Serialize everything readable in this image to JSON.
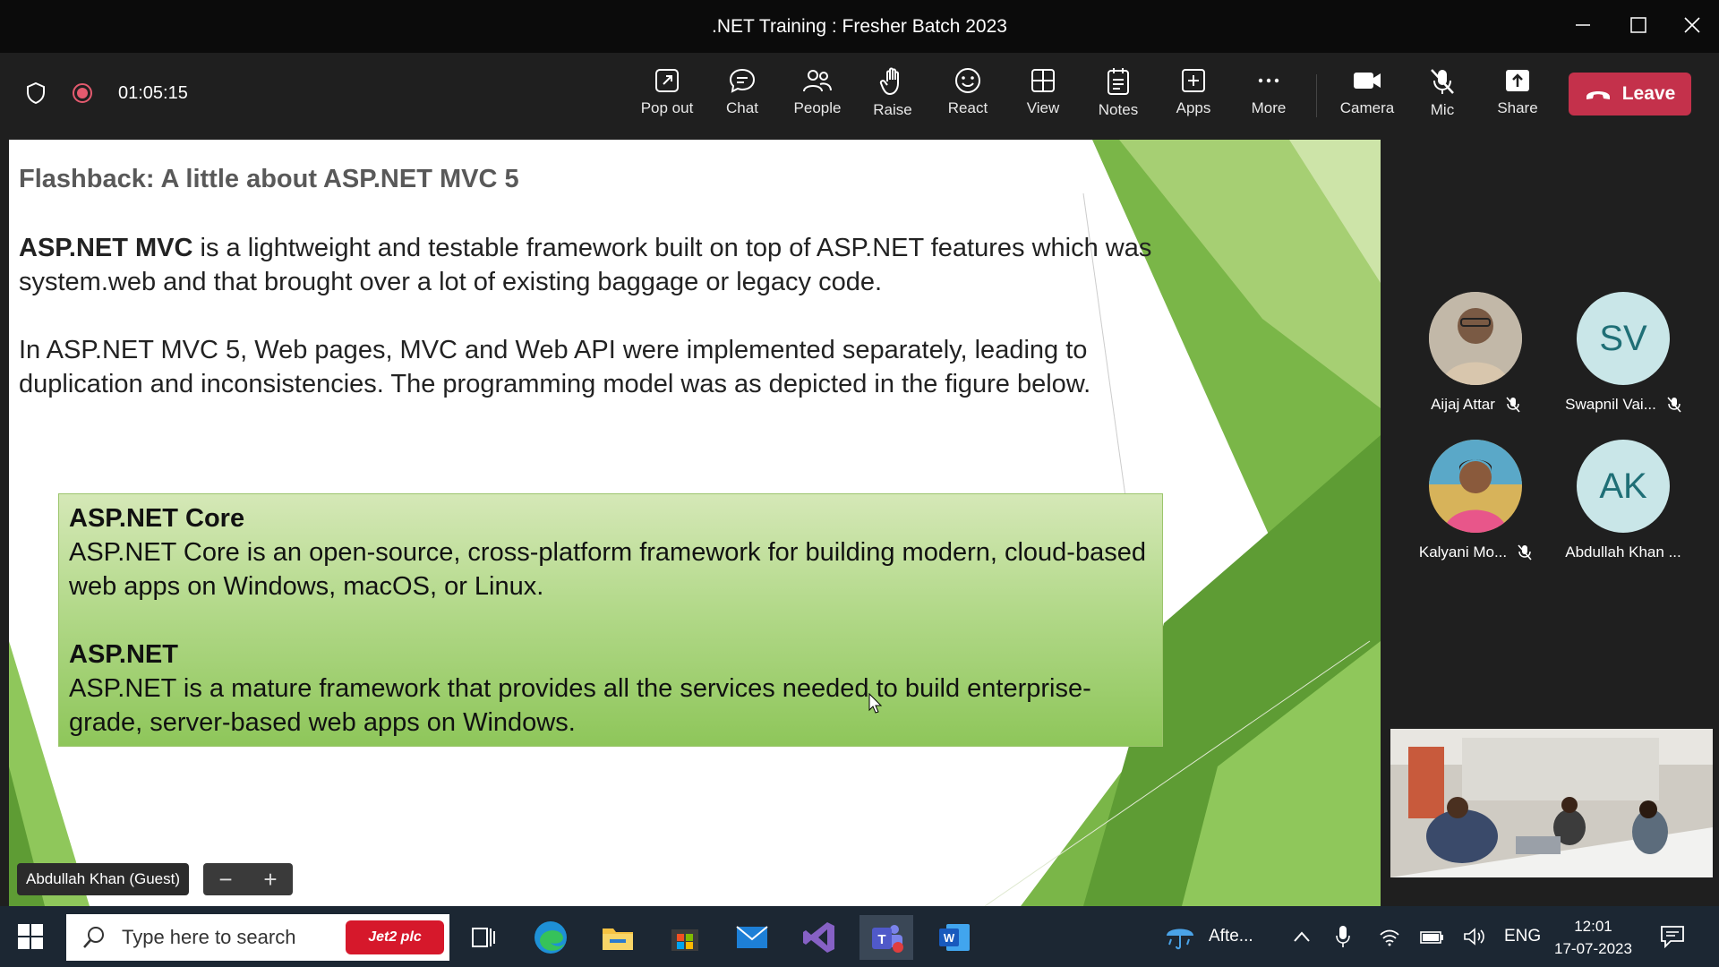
{
  "window": {
    "title": ".NET Training : Fresher Batch 2023"
  },
  "meeting": {
    "timer": "01:05:15",
    "leave_label": "Leave"
  },
  "toolbar": {
    "items": [
      {
        "label": "Pop out",
        "icon": "pop-out-icon"
      },
      {
        "label": "Chat",
        "icon": "chat-icon"
      },
      {
        "label": "People",
        "icon": "people-icon"
      },
      {
        "label": "Raise",
        "icon": "raise-hand-icon"
      },
      {
        "label": "React",
        "icon": "react-icon"
      },
      {
        "label": "View",
        "icon": "view-icon"
      },
      {
        "label": "Notes",
        "icon": "notes-icon"
      },
      {
        "label": "Apps",
        "icon": "apps-icon"
      },
      {
        "label": "More",
        "icon": "more-icon"
      },
      {
        "label": "Camera",
        "icon": "camera-icon"
      },
      {
        "label": "Mic",
        "icon": "mic-muted-icon"
      },
      {
        "label": "Share",
        "icon": "share-icon"
      }
    ]
  },
  "slide": {
    "title": "Flashback: A little about ASP.NET MVC 5",
    "para1_bold": "ASP.NET MVC",
    "para1_rest": " is a lightweight and testable framework built on top of ASP.NET features which was system.web and that brought over a lot of existing baggage or legacy code.",
    "para2": "In ASP.NET MVC 5, Web pages, MVC and Web API were implemented separately, leading to duplication and inconsistencies. The programming model was as depicted in the figure below.",
    "box": {
      "h1": "ASP.NET Core",
      "t1": "ASP.NET Core is an open-source, cross-platform framework for building modern, cloud-based web apps on Windows, macOS, or Linux.",
      "h2": "ASP.NET",
      "t2": "ASP.NET is a mature framework that provides all the services needed to build enterprise-grade, server-based web apps on Windows."
    },
    "presenter_tag": "Abdullah Khan (Guest)",
    "zoom_out": "−",
    "zoom_in": "+"
  },
  "participants": [
    {
      "name": "Aijaj Attar",
      "initials": "",
      "muted": true
    },
    {
      "name": "Swapnil Vai...",
      "initials": "SV",
      "muted": true
    },
    {
      "name": "Kalyani Mo...",
      "initials": "",
      "muted": true
    },
    {
      "name": "Abdullah Khan ...",
      "initials": "AK",
      "muted": false
    }
  ],
  "taskbar": {
    "search_placeholder": "Type here to search",
    "promo": "Jet2 plc",
    "weather": "Afte...",
    "language": "ENG",
    "time": "12:01",
    "date": "17-07-2023"
  },
  "colors": {
    "leave": "#c4314b",
    "accent_green": "#7ab648",
    "toolbar_bg": "#1f1f1f"
  }
}
